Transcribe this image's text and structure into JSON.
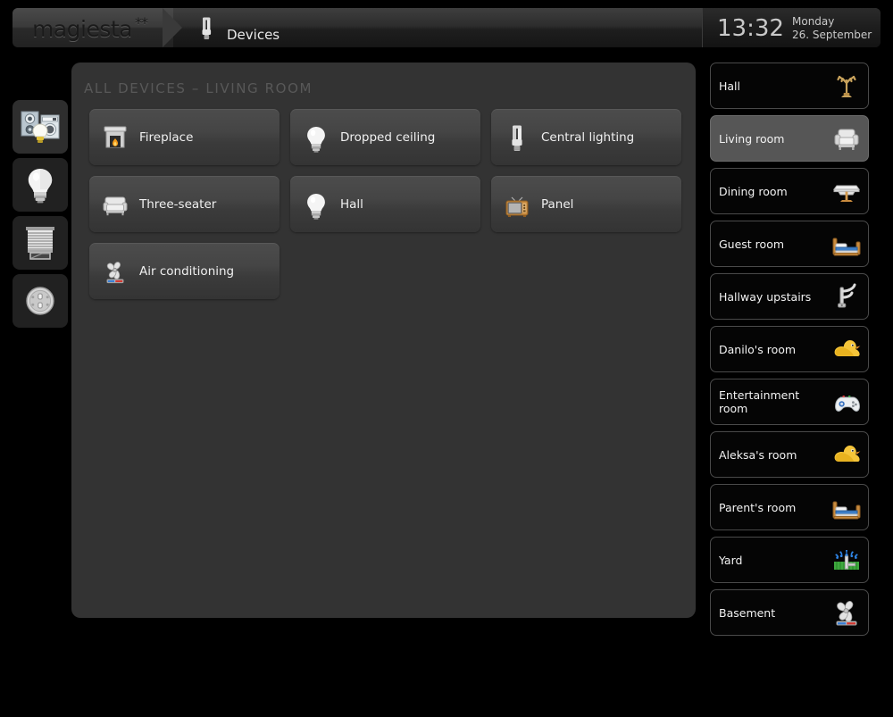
{
  "app": {
    "logo_text": "magiesta",
    "logo_stars": "**",
    "background_color": "#000000",
    "panel_color": "#333333",
    "selected_color": "#565656"
  },
  "header": {
    "icon": "cfl-bulb-icon",
    "title": "Devices",
    "clock": {
      "time": "13:32",
      "day": "Monday",
      "date": "26. September"
    }
  },
  "sidebar": {
    "items": [
      {
        "icon": "all-devices-icon",
        "name": "all-devices",
        "active": true
      },
      {
        "icon": "lightbulb-icon",
        "name": "lighting",
        "active": false
      },
      {
        "icon": "blinds-icon",
        "name": "blinds",
        "active": false
      },
      {
        "icon": "power-socket-icon",
        "name": "sockets",
        "active": false
      }
    ]
  },
  "main": {
    "title": "ALL DEVICES – LIVING ROOM",
    "devices": [
      {
        "label": "Fireplace",
        "icon": "fireplace-icon"
      },
      {
        "label": "Dropped ceiling",
        "icon": "lightbulb-icon"
      },
      {
        "label": "Central lighting",
        "icon": "cfl-bulb-icon"
      },
      {
        "label": "Three-seater",
        "icon": "sofa-icon"
      },
      {
        "label": "Hall",
        "icon": "lightbulb-icon"
      },
      {
        "label": "Panel",
        "icon": "tv-icon"
      },
      {
        "label": "Air conditioning",
        "icon": "ac-fan-icon"
      }
    ]
  },
  "rooms": {
    "items": [
      {
        "label": "Hall",
        "icon": "coat-rack-icon",
        "selected": false
      },
      {
        "label": "Living room",
        "icon": "armchair-icon",
        "selected": true
      },
      {
        "label": "Dining room",
        "icon": "dining-table-icon",
        "selected": false
      },
      {
        "label": "Guest room",
        "icon": "bed-icon",
        "selected": false
      },
      {
        "label": "Hallway upstairs",
        "icon": "coat-hook-icon",
        "selected": false
      },
      {
        "label": "Danilo's room",
        "icon": "rubber-duck-icon",
        "selected": false
      },
      {
        "label": "Entertainment room",
        "icon": "gamepad-icon",
        "selected": false
      },
      {
        "label": "Aleksa's room",
        "icon": "rubber-duck-icon",
        "selected": false
      },
      {
        "label": "Parent's room",
        "icon": "bed-icon",
        "selected": false
      },
      {
        "label": "Yard",
        "icon": "sprinkler-icon",
        "selected": false
      },
      {
        "label": "Basement",
        "icon": "ac-fan-icon",
        "selected": false
      }
    ]
  }
}
